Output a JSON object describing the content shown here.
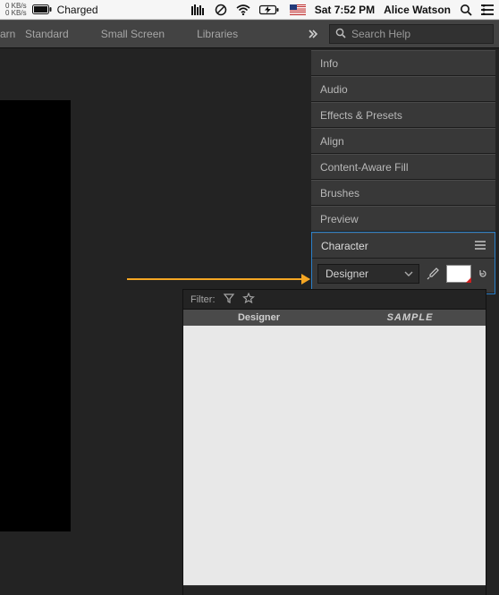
{
  "menubar": {
    "net_up": "0 KB/s",
    "net_down": "0 KB/s",
    "battery_label": "Charged",
    "datetime": "Sat 7:52 PM",
    "username": "Alice Watson"
  },
  "tabs": {
    "learn_fragment": "arn",
    "standard": "Standard",
    "small_screen": "Small Screen",
    "libraries": "Libraries"
  },
  "search": {
    "placeholder": "Search Help"
  },
  "panels": {
    "info": "Info",
    "audio": "Audio",
    "effects": "Effects & Presets",
    "align": "Align",
    "content_aware": "Content-Aware Fill",
    "brushes": "Brushes",
    "preview": "Preview",
    "character": "Character"
  },
  "character_panel": {
    "font_value": "Designer"
  },
  "font_popup": {
    "filter_label": "Filter:",
    "col_name": "Designer",
    "col_sample": "SAMPLE"
  }
}
